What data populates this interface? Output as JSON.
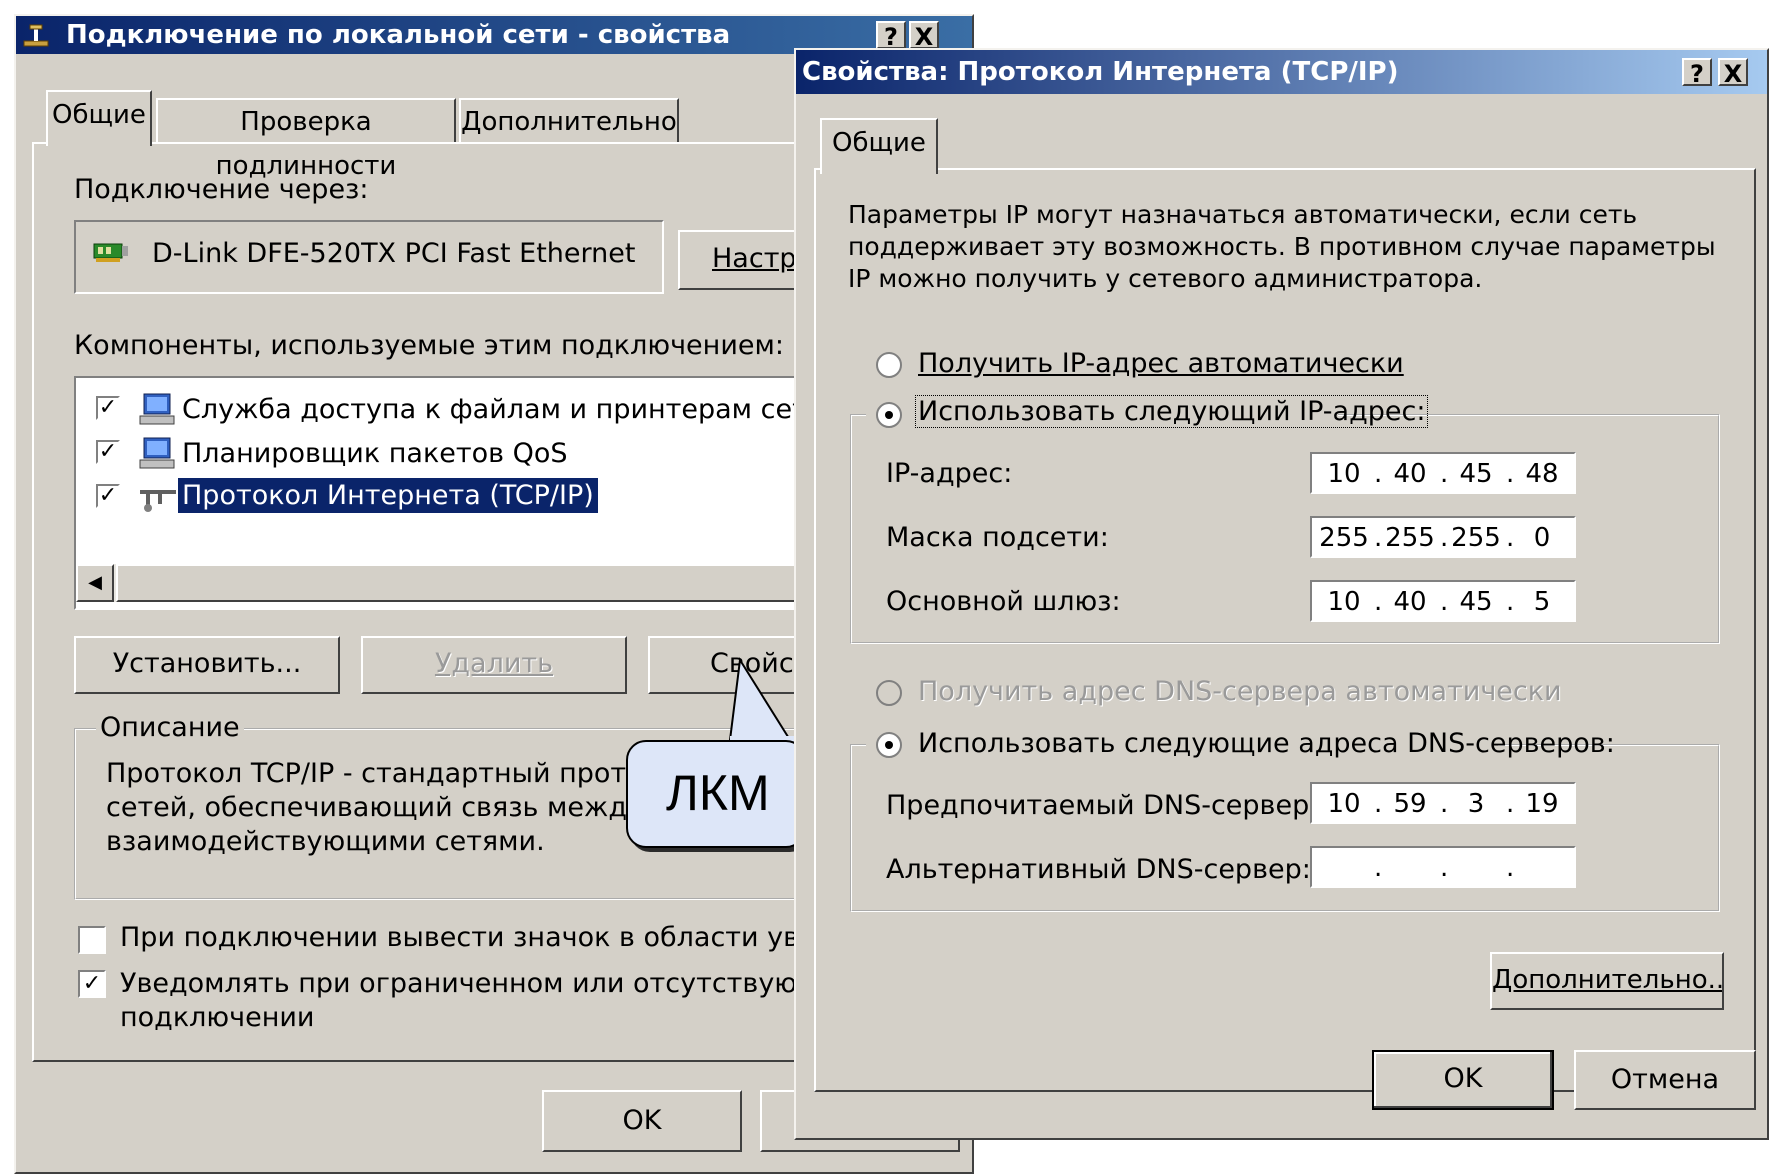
{
  "lan_dialog": {
    "title": "Подключение по локальной сети - свойства",
    "tabs": [
      "Общие",
      "Проверка подлинности",
      "Дополнительно"
    ],
    "connect_via_label": "Подключение через:",
    "adapter_name": "D-Link DFE-520TX PCI Fast Ethernet",
    "configure_button": "Настр",
    "components_label": "Компоненты, используемые этим подключением:",
    "components": [
      {
        "label": "Служба доступа к файлам и принтерам сетей",
        "checked": true
      },
      {
        "label": "Планировщик пакетов QoS",
        "checked": true
      },
      {
        "label": "Протокол Интернета (TCP/IP)",
        "checked": true,
        "selected": true
      }
    ],
    "install_button": "Установить...",
    "remove_button": "Удалить",
    "properties_button": "Свойс",
    "description_title": "Описание",
    "description_lines": [
      "Протокол TCP/IP - стандартный проток",
      "сетей, обеспечивающий связь между р",
      "взаимодействующими сетями."
    ],
    "show_icon_checkbox": {
      "label": "При подключении вывести значок в области уведо",
      "checked": false
    },
    "notify_checkbox": {
      "label_line1": "Уведомлять при ограниченном или отсутствующе",
      "label_line2": "подключении",
      "checked": true
    },
    "ok_button": "OK"
  },
  "callout": {
    "text": "ЛКМ"
  },
  "tcpip_dialog": {
    "title": "Свойства: Протокол Интернета (TCP/IP)",
    "help_button": "?",
    "close_button": "X",
    "tab": "Общие",
    "intro_lines": [
      "Параметры IP могут назначаться автоматически, если сеть",
      "поддерживает эту возможность. В противном случае параметры",
      "IP можно получить у сетевого администратора."
    ],
    "radio_auto_ip": {
      "label": "Получить IP-адрес автоматически",
      "selected": false
    },
    "radio_manual_ip": {
      "label": "Использовать следующий IP-адрес:",
      "selected": true
    },
    "ip_address_label": "IP-адрес:",
    "ip_address": [
      "10",
      "40",
      "45",
      "48"
    ],
    "subnet_label": "Маска подсети:",
    "subnet_mask": [
      "255",
      "255",
      "255",
      "0"
    ],
    "gateway_label": "Основной шлюз:",
    "gateway": [
      "10",
      "40",
      "45",
      "5"
    ],
    "radio_auto_dns": {
      "label": "Получить адрес DNS-сервера автоматически",
      "selected": false,
      "disabled": true
    },
    "radio_manual_dns": {
      "label": "Использовать следующие адреса DNS-серверов:",
      "selected": true
    },
    "preferred_dns_label": "Предпочитаемый DNS-сервер:",
    "preferred_dns": [
      "10",
      "59",
      "3",
      "19"
    ],
    "alternate_dns_label": "Альтернативный DNS-сервер:",
    "alternate_dns": [
      "",
      "",
      "",
      ""
    ],
    "advanced_button": "Дополнительно...",
    "ok_button": "OK",
    "cancel_button": "Отмена"
  },
  "colors": {
    "titlebar_start": "#0a246a",
    "titlebar_end": "#a6caf0",
    "dialog_bg": "#d4d0c8",
    "selection": "#0a246a"
  }
}
